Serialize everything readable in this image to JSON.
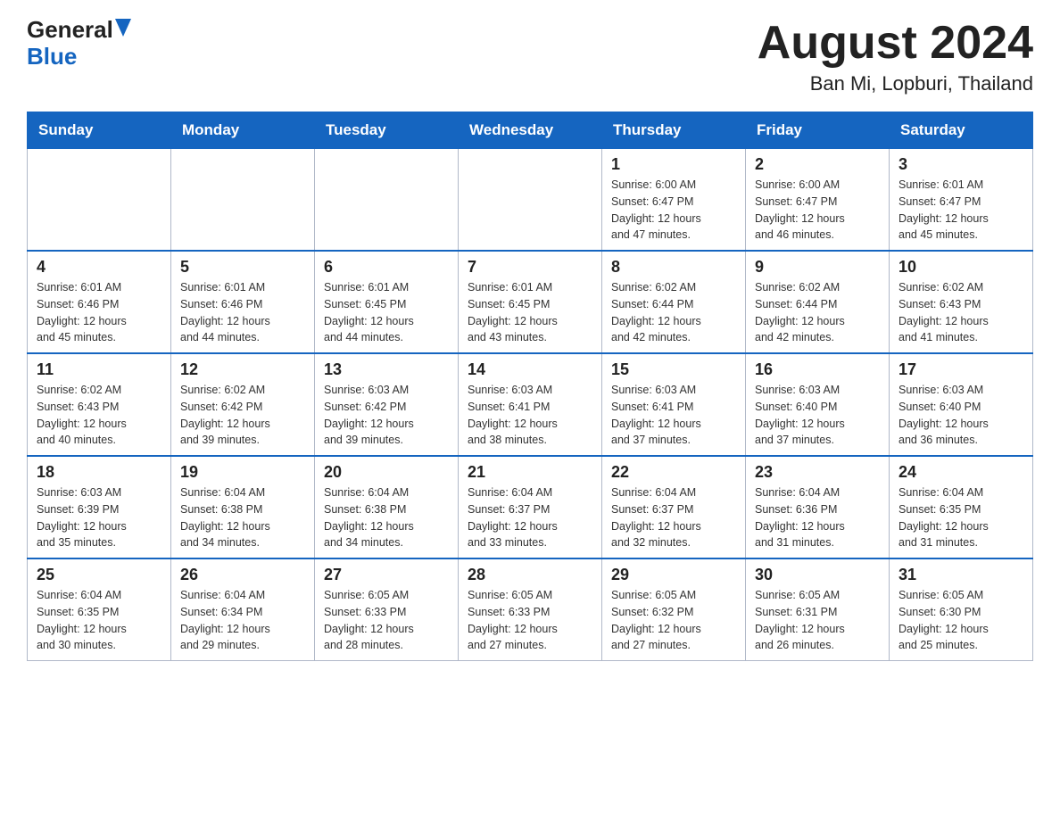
{
  "header": {
    "logo_general": "General",
    "logo_blue": "Blue",
    "month_title": "August 2024",
    "location": "Ban Mi, Lopburi, Thailand"
  },
  "days_of_week": [
    "Sunday",
    "Monday",
    "Tuesday",
    "Wednesday",
    "Thursday",
    "Friday",
    "Saturday"
  ],
  "weeks": [
    [
      {
        "day": "",
        "info": ""
      },
      {
        "day": "",
        "info": ""
      },
      {
        "day": "",
        "info": ""
      },
      {
        "day": "",
        "info": ""
      },
      {
        "day": "1",
        "info": "Sunrise: 6:00 AM\nSunset: 6:47 PM\nDaylight: 12 hours\nand 47 minutes."
      },
      {
        "day": "2",
        "info": "Sunrise: 6:00 AM\nSunset: 6:47 PM\nDaylight: 12 hours\nand 46 minutes."
      },
      {
        "day": "3",
        "info": "Sunrise: 6:01 AM\nSunset: 6:47 PM\nDaylight: 12 hours\nand 45 minutes."
      }
    ],
    [
      {
        "day": "4",
        "info": "Sunrise: 6:01 AM\nSunset: 6:46 PM\nDaylight: 12 hours\nand 45 minutes."
      },
      {
        "day": "5",
        "info": "Sunrise: 6:01 AM\nSunset: 6:46 PM\nDaylight: 12 hours\nand 44 minutes."
      },
      {
        "day": "6",
        "info": "Sunrise: 6:01 AM\nSunset: 6:45 PM\nDaylight: 12 hours\nand 44 minutes."
      },
      {
        "day": "7",
        "info": "Sunrise: 6:01 AM\nSunset: 6:45 PM\nDaylight: 12 hours\nand 43 minutes."
      },
      {
        "day": "8",
        "info": "Sunrise: 6:02 AM\nSunset: 6:44 PM\nDaylight: 12 hours\nand 42 minutes."
      },
      {
        "day": "9",
        "info": "Sunrise: 6:02 AM\nSunset: 6:44 PM\nDaylight: 12 hours\nand 42 minutes."
      },
      {
        "day": "10",
        "info": "Sunrise: 6:02 AM\nSunset: 6:43 PM\nDaylight: 12 hours\nand 41 minutes."
      }
    ],
    [
      {
        "day": "11",
        "info": "Sunrise: 6:02 AM\nSunset: 6:43 PM\nDaylight: 12 hours\nand 40 minutes."
      },
      {
        "day": "12",
        "info": "Sunrise: 6:02 AM\nSunset: 6:42 PM\nDaylight: 12 hours\nand 39 minutes."
      },
      {
        "day": "13",
        "info": "Sunrise: 6:03 AM\nSunset: 6:42 PM\nDaylight: 12 hours\nand 39 minutes."
      },
      {
        "day": "14",
        "info": "Sunrise: 6:03 AM\nSunset: 6:41 PM\nDaylight: 12 hours\nand 38 minutes."
      },
      {
        "day": "15",
        "info": "Sunrise: 6:03 AM\nSunset: 6:41 PM\nDaylight: 12 hours\nand 37 minutes."
      },
      {
        "day": "16",
        "info": "Sunrise: 6:03 AM\nSunset: 6:40 PM\nDaylight: 12 hours\nand 37 minutes."
      },
      {
        "day": "17",
        "info": "Sunrise: 6:03 AM\nSunset: 6:40 PM\nDaylight: 12 hours\nand 36 minutes."
      }
    ],
    [
      {
        "day": "18",
        "info": "Sunrise: 6:03 AM\nSunset: 6:39 PM\nDaylight: 12 hours\nand 35 minutes."
      },
      {
        "day": "19",
        "info": "Sunrise: 6:04 AM\nSunset: 6:38 PM\nDaylight: 12 hours\nand 34 minutes."
      },
      {
        "day": "20",
        "info": "Sunrise: 6:04 AM\nSunset: 6:38 PM\nDaylight: 12 hours\nand 34 minutes."
      },
      {
        "day": "21",
        "info": "Sunrise: 6:04 AM\nSunset: 6:37 PM\nDaylight: 12 hours\nand 33 minutes."
      },
      {
        "day": "22",
        "info": "Sunrise: 6:04 AM\nSunset: 6:37 PM\nDaylight: 12 hours\nand 32 minutes."
      },
      {
        "day": "23",
        "info": "Sunrise: 6:04 AM\nSunset: 6:36 PM\nDaylight: 12 hours\nand 31 minutes."
      },
      {
        "day": "24",
        "info": "Sunrise: 6:04 AM\nSunset: 6:35 PM\nDaylight: 12 hours\nand 31 minutes."
      }
    ],
    [
      {
        "day": "25",
        "info": "Sunrise: 6:04 AM\nSunset: 6:35 PM\nDaylight: 12 hours\nand 30 minutes."
      },
      {
        "day": "26",
        "info": "Sunrise: 6:04 AM\nSunset: 6:34 PM\nDaylight: 12 hours\nand 29 minutes."
      },
      {
        "day": "27",
        "info": "Sunrise: 6:05 AM\nSunset: 6:33 PM\nDaylight: 12 hours\nand 28 minutes."
      },
      {
        "day": "28",
        "info": "Sunrise: 6:05 AM\nSunset: 6:33 PM\nDaylight: 12 hours\nand 27 minutes."
      },
      {
        "day": "29",
        "info": "Sunrise: 6:05 AM\nSunset: 6:32 PM\nDaylight: 12 hours\nand 27 minutes."
      },
      {
        "day": "30",
        "info": "Sunrise: 6:05 AM\nSunset: 6:31 PM\nDaylight: 12 hours\nand 26 minutes."
      },
      {
        "day": "31",
        "info": "Sunrise: 6:05 AM\nSunset: 6:30 PM\nDaylight: 12 hours\nand 25 minutes."
      }
    ]
  ]
}
